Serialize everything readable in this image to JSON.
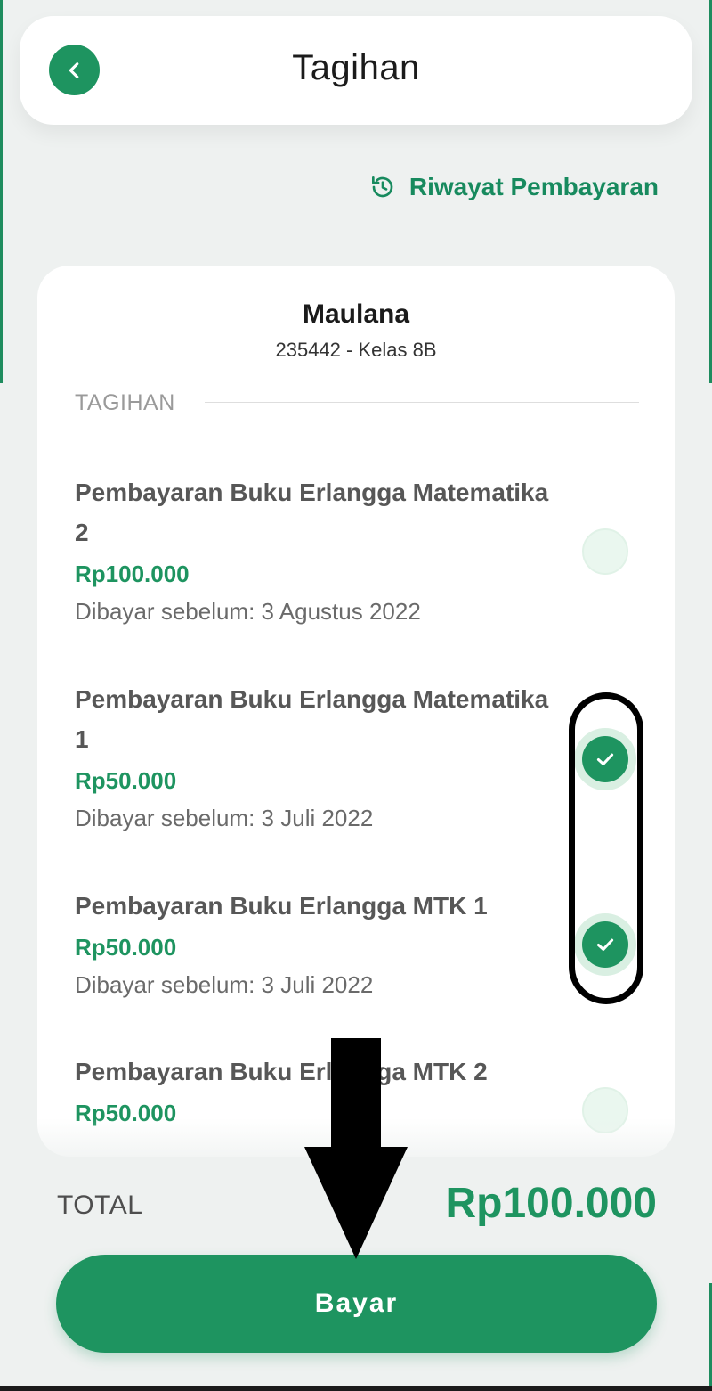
{
  "header": {
    "title": "Tagihan"
  },
  "history_link": {
    "label": "Riwayat Pembayaran"
  },
  "student": {
    "name": "Maulana",
    "meta": "235442 - Kelas 8B"
  },
  "section": {
    "label": "TAGIHAN"
  },
  "bills": [
    {
      "title": "Pembayaran Buku Erlangga Matematika 2",
      "amount": "Rp100.000",
      "due_prefix": "Dibayar sebelum:",
      "due_date": "3 Agustus 2022",
      "selected": false
    },
    {
      "title": "Pembayaran Buku Erlangga Matematika 1",
      "amount": "Rp50.000",
      "due_prefix": "Dibayar sebelum:",
      "due_date": "3 Juli 2022",
      "selected": true
    },
    {
      "title": "Pembayaran Buku Erlangga MTK 1",
      "amount": "Rp50.000",
      "due_prefix": "Dibayar sebelum:",
      "due_date": "3 Juli 2022",
      "selected": true
    },
    {
      "title": "Pembayaran Buku Erlangga MTK 2",
      "amount": "Rp50.000",
      "selected": false
    }
  ],
  "total": {
    "label": "TOTAL",
    "value": "Rp100.000"
  },
  "pay_button": {
    "label": "Bayar"
  },
  "colors": {
    "primary": "#1e9460",
    "background": "#eef1f0",
    "card": "#ffffff",
    "annotation": "#000000"
  },
  "icons": {
    "back": "chevron-left-icon",
    "history": "history-clock-icon",
    "check": "check-icon"
  }
}
